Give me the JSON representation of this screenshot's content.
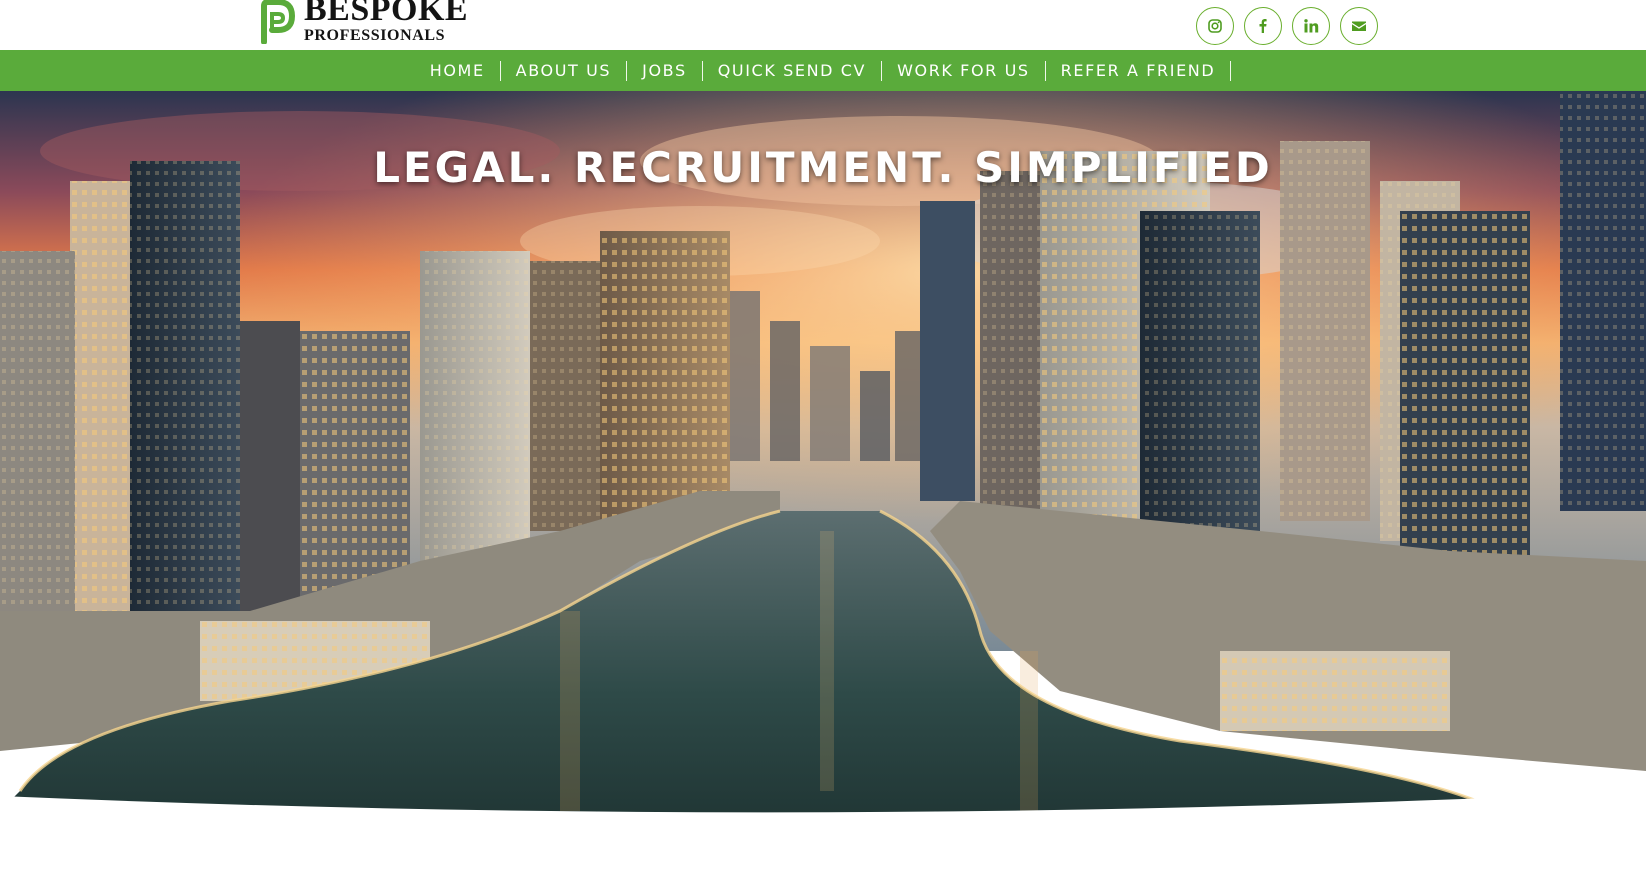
{
  "logo": {
    "line1": "BESPOKE",
    "line2": "PROFESSIONALS",
    "mark_color": "#5aab3b"
  },
  "socials": [
    {
      "icon": "instagram-icon"
    },
    {
      "icon": "facebook-icon"
    },
    {
      "icon": "linkedin-icon"
    },
    {
      "icon": "envelope-icon"
    }
  ],
  "nav": {
    "background": "#5aab3b",
    "items": [
      {
        "label": "Home"
      },
      {
        "label": "About Us"
      },
      {
        "label": "Jobs"
      },
      {
        "label": "Quick Send CV"
      },
      {
        "label": "Work For Us"
      },
      {
        "label": "Refer A Friend"
      }
    ]
  },
  "hero": {
    "title": "LEGAL. RECRUITMENT. SIMPLIFIED",
    "image": "dubai-marina-sunset-skyline"
  }
}
